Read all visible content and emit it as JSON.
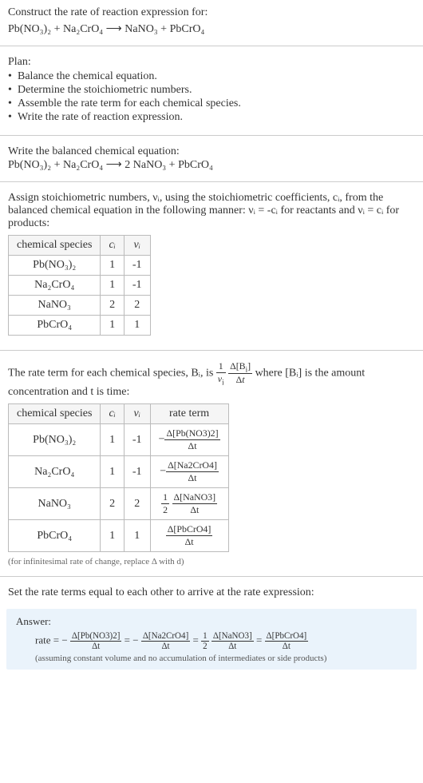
{
  "header": {
    "title": "Construct the rate of reaction expression for:",
    "equation": "Pb(NO₃)₂ + Na₂CrO₄ ⟶ NaNO₃ + PbCrO₄"
  },
  "plan": {
    "label": "Plan:",
    "items": [
      "Balance the chemical equation.",
      "Determine the stoichiometric numbers.",
      "Assemble the rate term for each chemical species.",
      "Write the rate of reaction expression."
    ]
  },
  "balanced": {
    "label": "Write the balanced chemical equation:",
    "equation": "Pb(NO₃)₂ + Na₂CrO₄ ⟶ 2 NaNO₃ + PbCrO₄"
  },
  "assign": {
    "intro": "Assign stoichiometric numbers, νᵢ, using the stoichiometric coefficients, cᵢ, from the balanced chemical equation in the following manner: νᵢ = -cᵢ for reactants and νᵢ = cᵢ for products:",
    "table": {
      "headers": [
        "chemical species",
        "cᵢ",
        "νᵢ"
      ],
      "rows": [
        [
          "Pb(NO₃)₂",
          "1",
          "-1"
        ],
        [
          "Na₂CrO₄",
          "1",
          "-1"
        ],
        [
          "NaNO₃",
          "2",
          "2"
        ],
        [
          "PbCrO₄",
          "1",
          "1"
        ]
      ]
    }
  },
  "rateterm": {
    "intro_a": "The rate term for each chemical species, Bᵢ, is ",
    "intro_b": " where [Bᵢ] is the amount concentration and t is time:",
    "table": {
      "headers": [
        "chemical species",
        "cᵢ",
        "νᵢ",
        "rate term"
      ],
      "rows": [
        {
          "sp": "Pb(NO₃)₂",
          "c": "1",
          "v": "-1",
          "term_prefix": "−",
          "term_num": "Δ[Pb(NO3)2]",
          "term_den": "Δt",
          "half": ""
        },
        {
          "sp": "Na₂CrO₄",
          "c": "1",
          "v": "-1",
          "term_prefix": "−",
          "term_num": "Δ[Na2CrO4]",
          "term_den": "Δt",
          "half": ""
        },
        {
          "sp": "NaNO₃",
          "c": "2",
          "v": "2",
          "term_prefix": "",
          "term_num": "Δ[NaNO3]",
          "term_den": "Δt",
          "half": "½ "
        },
        {
          "sp": "PbCrO₄",
          "c": "1",
          "v": "1",
          "term_prefix": "",
          "term_num": "Δ[PbCrO4]",
          "term_den": "Δt",
          "half": ""
        }
      ]
    },
    "note": "(for infinitesimal rate of change, replace Δ with d)"
  },
  "final": {
    "label": "Set the rate terms equal to each other to arrive at the rate expression:"
  },
  "answer": {
    "label": "Answer:",
    "prefix": "rate = − ",
    "t1_num": "Δ[Pb(NO3)2]",
    "t1_den": "Δt",
    "eq1": " = − ",
    "t2_num": "Δ[Na2CrO4]",
    "t2_den": "Δt",
    "eq2": " = ",
    "half_num": "1",
    "half_den": "2",
    "t3_num": "Δ[NaNO3]",
    "t3_den": "Δt",
    "eq3": " = ",
    "t4_num": "Δ[PbCrO4]",
    "t4_den": "Δt",
    "note": "(assuming constant volume and no accumulation of intermediates or side products)"
  }
}
